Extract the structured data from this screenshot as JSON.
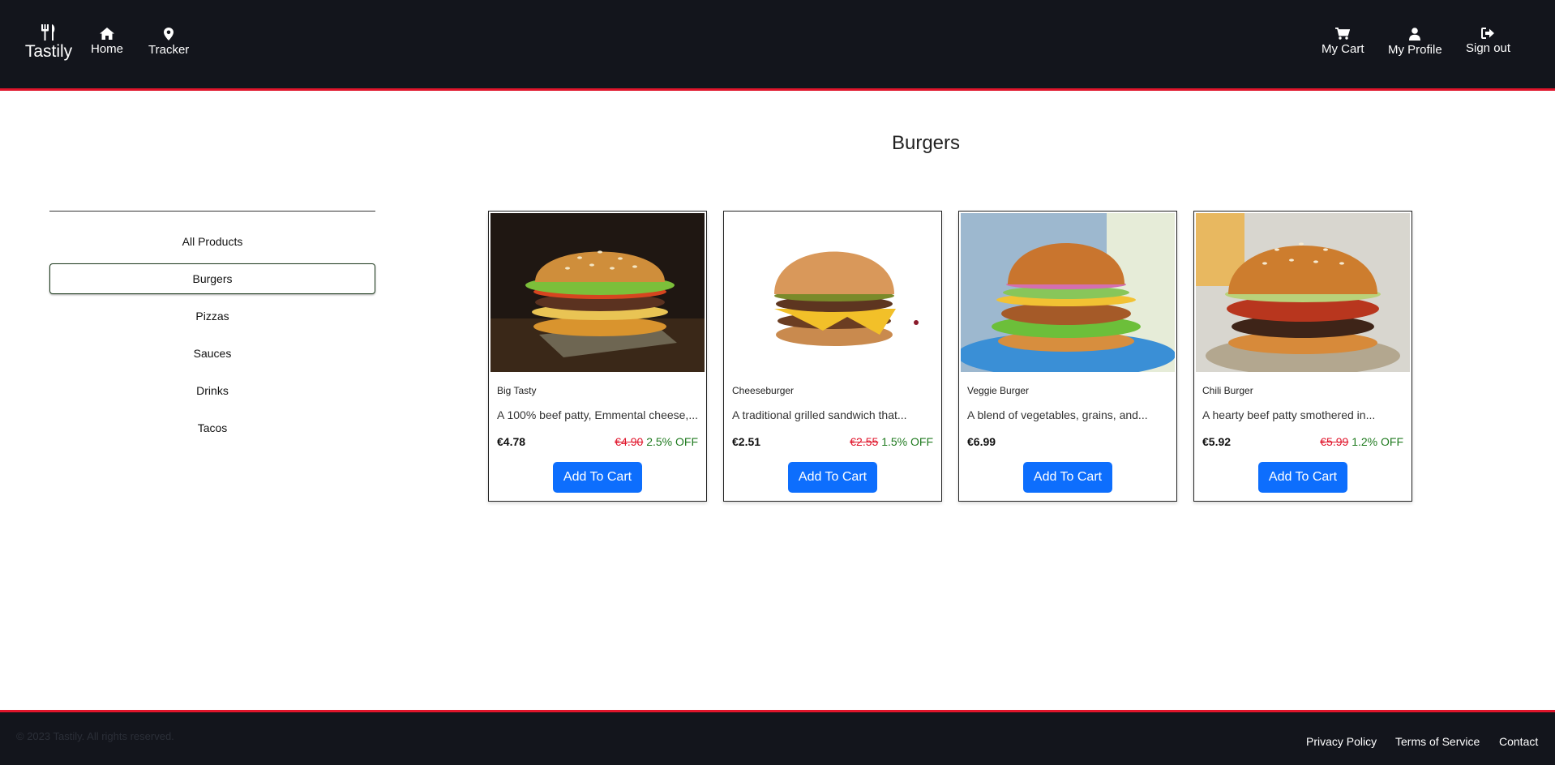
{
  "brand": {
    "name": "Tastily",
    "icon": "utensils-icon"
  },
  "nav": {
    "left": [
      {
        "label": "Home",
        "icon": "home-icon"
      },
      {
        "label": "Tracker",
        "icon": "map-pin-icon"
      }
    ],
    "right": [
      {
        "label": "My Cart",
        "icon": "cart-icon"
      },
      {
        "label": "My Profile",
        "icon": "user-icon"
      },
      {
        "label": "Sign out",
        "icon": "sign-out-icon"
      }
    ]
  },
  "page": {
    "title": "Burgers"
  },
  "categories": {
    "active": "Burgers",
    "items": [
      "All Products",
      "Burgers",
      "Pizzas",
      "Sauces",
      "Drinks",
      "Tacos"
    ]
  },
  "products": [
    {
      "name": "Big Tasty",
      "description": "A 100% beef patty, Emmental cheese,...",
      "price": "€4.78",
      "old_price": "€4.90",
      "discount": "2.5% OFF",
      "button": "Add To Cart"
    },
    {
      "name": "Cheeseburger",
      "description": "A traditional grilled sandwich that...",
      "price": "€2.51",
      "old_price": "€2.55",
      "discount": "1.5% OFF",
      "button": "Add To Cart"
    },
    {
      "name": "Veggie Burger",
      "description": "A blend of vegetables, grains, and...",
      "price": "€6.99",
      "old_price": "",
      "discount": "",
      "button": "Add To Cart"
    },
    {
      "name": "Chili Burger",
      "description": "A hearty beef patty smothered in...",
      "price": "€5.92",
      "old_price": "€5.99",
      "discount": "1.2% OFF",
      "button": "Add To Cart"
    }
  ],
  "footer": {
    "copyright": "© 2023 Tastily. All rights reserved.",
    "links": [
      "Privacy Policy",
      "Terms of Service",
      "Contact"
    ]
  },
  "colors": {
    "header_bg": "#13151c",
    "accent_red": "#e0152b",
    "button_blue": "#0d6efd",
    "discount_green": "#1f7a1f"
  }
}
